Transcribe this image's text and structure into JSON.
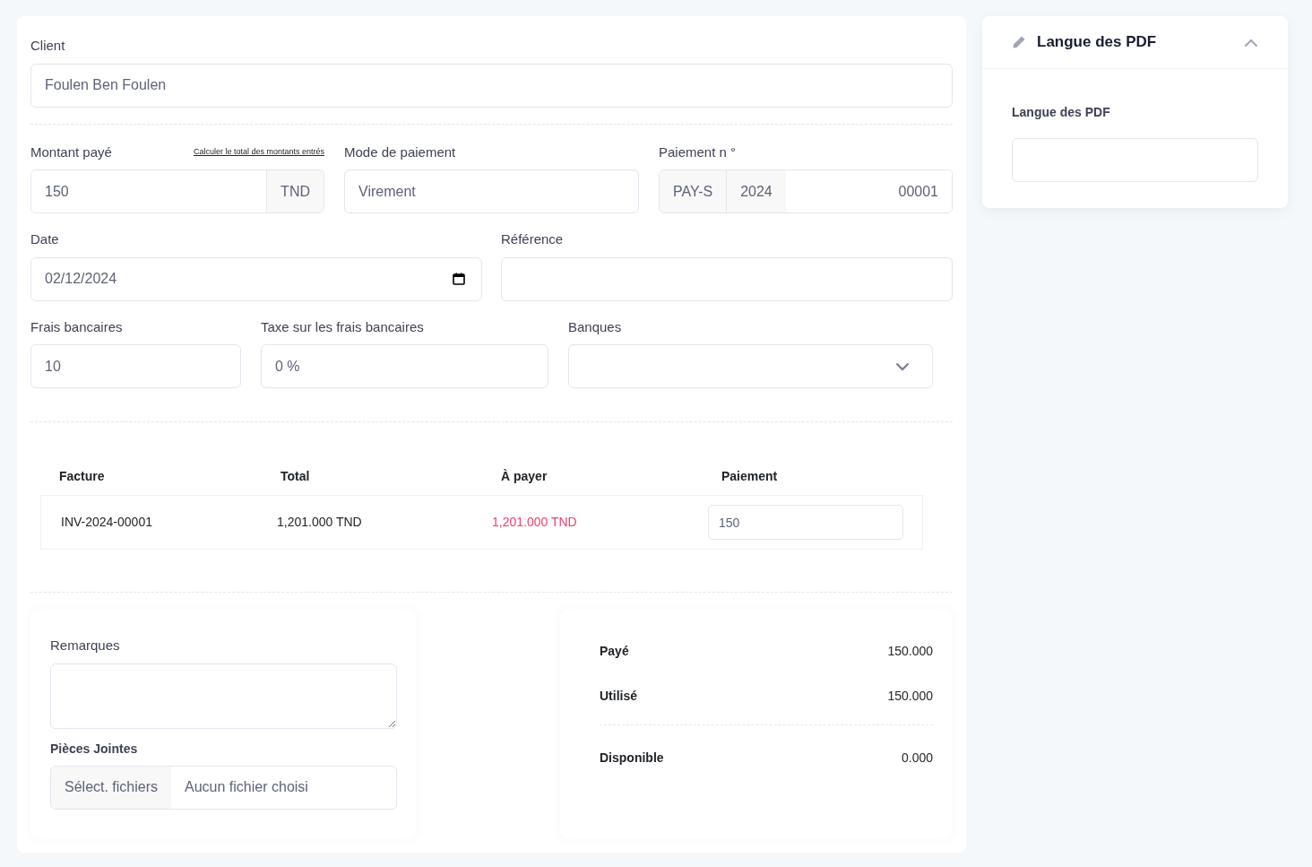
{
  "client": {
    "label": "Client",
    "value": "Foulen Ben Foulen"
  },
  "amount": {
    "label": "Montant payé",
    "link": "Calculer le total des montants entrés",
    "value": "150",
    "currency": "TND"
  },
  "payment_mode": {
    "label": "Mode de paiement",
    "value": "Virement"
  },
  "payment_number": {
    "label": "Paiement n °",
    "prefix": "PAY-S",
    "year": "2024",
    "value": "00001"
  },
  "date": {
    "label": "Date",
    "value": "02/12/2024"
  },
  "reference": {
    "label": "Référence"
  },
  "bank_fees": {
    "label": "Frais bancaires",
    "value": "10"
  },
  "fee_tax": {
    "label": "Taxe sur les frais bancaires",
    "value": "0 %"
  },
  "banks": {
    "label": "Banques"
  },
  "invoices": {
    "columns": [
      "Facture",
      "Total",
      "À payer",
      "Paiement"
    ],
    "rows": [
      {
        "invoice": "INV-2024-00001",
        "total": "1,201.000 TND",
        "due": "1,201.000 TND",
        "payment": "150"
      }
    ]
  },
  "remarks": {
    "label": "Remarques"
  },
  "attachments": {
    "label": "Pièces Jointes",
    "button": "Sélect. fichiers",
    "status": "Aucun fichier choisi"
  },
  "summary": {
    "rows": [
      {
        "label": "Payé",
        "value": "150.000"
      },
      {
        "label": "Utilisé",
        "value": "150.000"
      }
    ],
    "total": {
      "label": "Disponible",
      "value": "0.000"
    }
  },
  "sidebar": {
    "title": "Langue des PDF",
    "expanded": true,
    "field_label": "Langue des PDF"
  }
}
